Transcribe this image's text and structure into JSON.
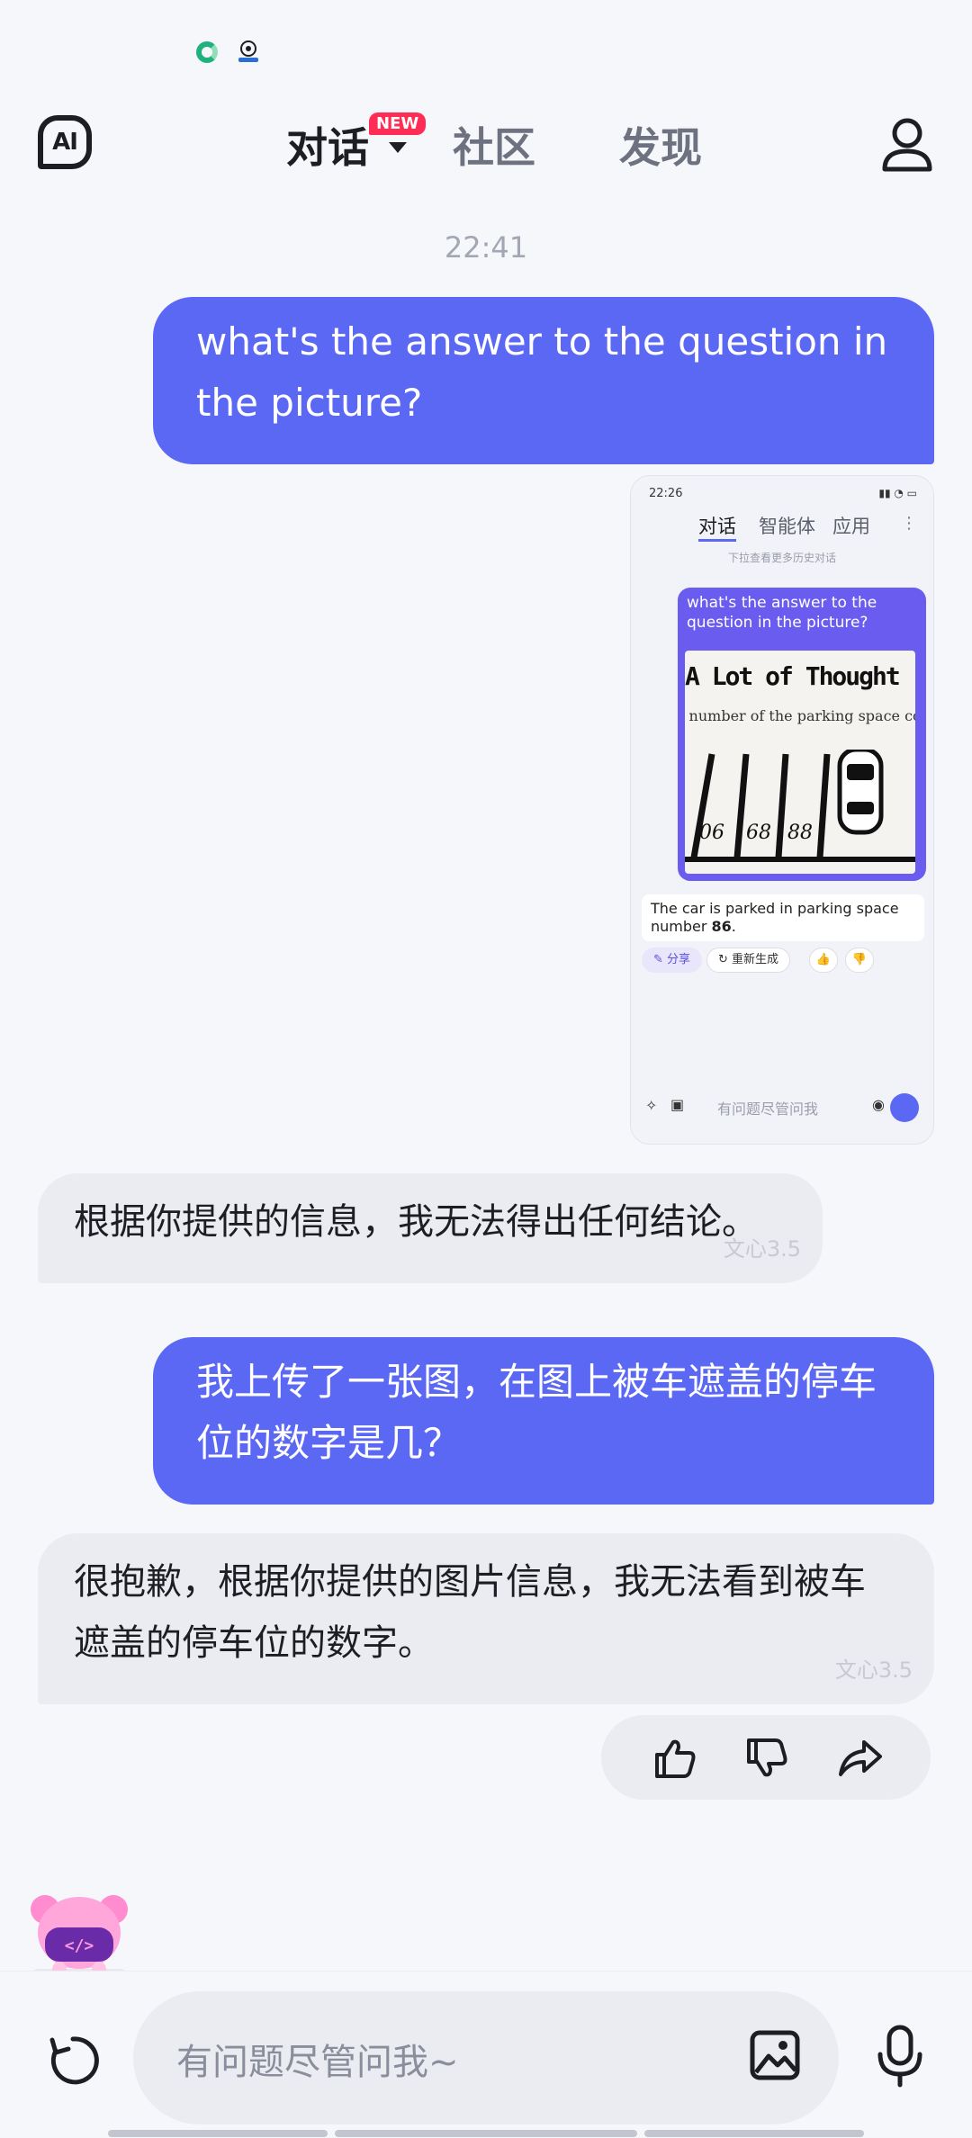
{
  "header": {
    "tabs": [
      {
        "label": "对话",
        "active": true,
        "badge": "NEW"
      },
      {
        "label": "社区",
        "active": false
      },
      {
        "label": "发现",
        "active": false
      }
    ]
  },
  "conversation": {
    "timestamp": "22:41",
    "messages": [
      {
        "role": "user",
        "text": "what's the answer to the question in the picture?"
      },
      {
        "role": "user-image",
        "screenshot": {
          "status_time": "22:26",
          "tabs": [
            "对话",
            "智能体",
            "应用"
          ],
          "history_hint": "下拉查看更多历史对话",
          "question": "what's the answer to the question in the picture?",
          "photo_title": "A Lot of Thought",
          "photo_subtitle": "e number of the parking space cor",
          "parking_numbers": [
            "06",
            "68",
            "88"
          ],
          "answer_prefix": "The car is parked in parking space number ",
          "answer_number": "86",
          "answer_suffix": ".",
          "share_label": "分享",
          "regenerate_label": "重新生成",
          "input_placeholder": "有问题尽管问我"
        }
      },
      {
        "role": "assistant",
        "text": "根据你提供的信息，我无法得出任何结论。",
        "model": "文心3.5"
      },
      {
        "role": "user",
        "text": "我上传了一张图，在图上被车遮盖的停车位的数字是几？"
      },
      {
        "role": "assistant",
        "text": "很抱歉，根据你提供的图片信息，我无法看到被车遮盖的停车位的数字。",
        "model": "文心3.5"
      }
    ]
  },
  "input": {
    "placeholder": "有问题尽管问我~"
  },
  "colors": {
    "accent": "#5b68f3",
    "badge": "#ff2d55",
    "ai_bubble": "#ebecf2"
  }
}
